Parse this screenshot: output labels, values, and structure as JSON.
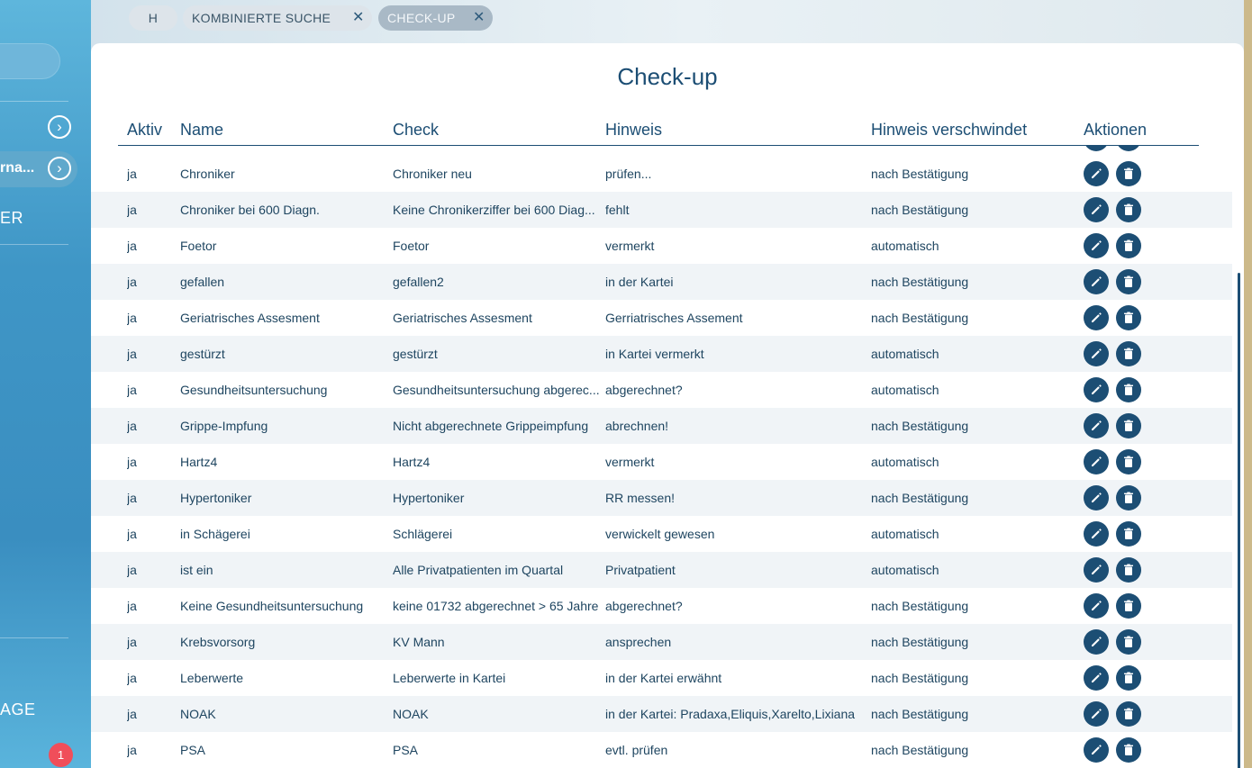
{
  "sidebar": {
    "active_item_label": "rna...",
    "item_label_1": "ER",
    "item_label_2": "AGE",
    "notification_count": "1"
  },
  "tabs": [
    {
      "label": "H"
    },
    {
      "label": "KOMBINIERTE SUCHE",
      "close": "✕"
    },
    {
      "label": "CHECK-UP",
      "close": "✕"
    }
  ],
  "page": {
    "title": "Check-up"
  },
  "table": {
    "headers": [
      "Aktiv",
      "Name",
      "Check",
      "Hinweis",
      "Hinweis verschwindet",
      "Aktionen"
    ],
    "rows": [
      [
        "ja",
        "Chroniker",
        "Chroniker neu",
        "prüfen...",
        "nach Bestätigung"
      ],
      [
        "ja",
        "Chroniker bei 600 Diagn.",
        "Keine Chronikerziffer bei 600 Diag...",
        "fehlt",
        "nach Bestätigung"
      ],
      [
        "ja",
        "Foetor",
        "Foetor",
        "vermerkt",
        "automatisch"
      ],
      [
        "ja",
        "gefallen",
        "gefallen2",
        "in der Kartei",
        "nach Bestätigung"
      ],
      [
        "ja",
        "Geriatrisches Assesment",
        "Geriatrisches Assesment",
        "Gerriatrisches Assement",
        "nach Bestätigung"
      ],
      [
        "ja",
        "gestürzt",
        "gestürzt",
        "in Kartei vermerkt",
        "automatisch"
      ],
      [
        "ja",
        "Gesundheitsuntersuchung",
        "Gesundheitsuntersuchung abgerec...",
        "abgerechnet?",
        "automatisch"
      ],
      [
        "ja",
        "Grippe-Impfung",
        "Nicht abgerechnete Grippeimpfung",
        "abrechnen!",
        "nach Bestätigung"
      ],
      [
        "ja",
        "Hartz4",
        "Hartz4",
        "vermerkt",
        "automatisch"
      ],
      [
        "ja",
        "Hypertoniker",
        "Hypertoniker",
        "RR messen!",
        "nach Bestätigung"
      ],
      [
        "ja",
        "in Schägerei",
        "Schlägerei",
        "verwickelt gewesen",
        "automatisch"
      ],
      [
        "ja",
        "ist ein",
        "Alle Privatpatienten im Quartal",
        "Privatpatient",
        "automatisch"
      ],
      [
        "ja",
        "Keine Gesundheitsuntersuchung",
        "keine 01732  abgerechnet > 65 Jahre",
        "abgerechnet?",
        "nach Bestätigung"
      ],
      [
        "ja",
        "Krebsvorsorg",
        "KV Mann",
        "ansprechen",
        "nach Bestätigung"
      ],
      [
        "ja",
        "Leberwerte",
        "Leberwerte in Kartei",
        "in der Kartei erwähnt",
        "nach Bestätigung"
      ],
      [
        "ja",
        "NOAK",
        "NOAK",
        "in der Kartei: Pradaxa,Eliquis,Xarelto,Lixiana",
        "nach Bestätigung"
      ],
      [
        "ja",
        "PSA",
        "PSA",
        "evtl. prüfen",
        "nach Bestätigung"
      ]
    ]
  },
  "icons": {
    "edit": "pencil-icon",
    "delete": "trash-icon",
    "nav": "chevron-right-circle-icon"
  },
  "colors": {
    "accent": "#1c4e74",
    "sidebar": "#3f96c6",
    "badge": "#f04e5a",
    "alt_row": "#f0f4f7"
  }
}
